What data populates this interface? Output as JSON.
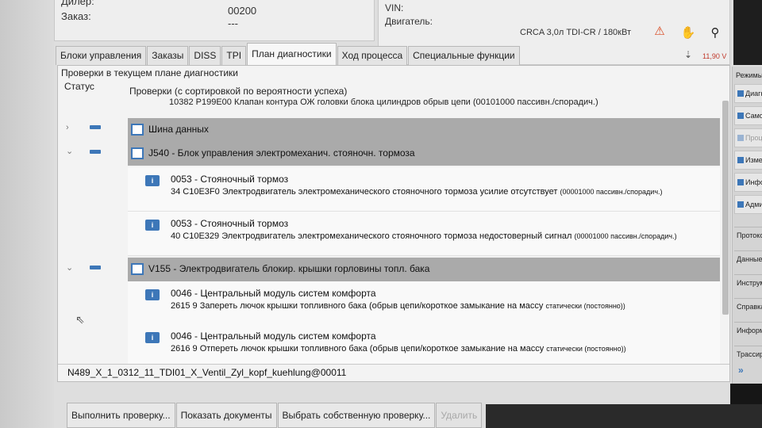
{
  "header": {
    "dealer_label": "Дилер:",
    "order_label": "Заказ:",
    "dealer_value": "00200",
    "order_value": "---",
    "vin_label": "VIN:",
    "engine_label": "Двигатель:",
    "engine_value": "CRCA 3,0л TDI-CR / 180кВт",
    "voltage": "11,90 V"
  },
  "tabs": [
    {
      "label": "Блоки управления"
    },
    {
      "label": "Заказы"
    },
    {
      "label": "DISS"
    },
    {
      "label": "TPI"
    },
    {
      "label": "План диагностики"
    },
    {
      "label": "Ход процесса"
    },
    {
      "label": "Специальные функции"
    }
  ],
  "plan": {
    "title": "Проверки в текущем плане диагностики",
    "status_header": "Статус",
    "checks_header": "Проверки (с сортировкой по вероятности успеха)",
    "main_fault": "10382   P199E00   Клапан контура ОЖ головки блока цилиндров обрыв цепи  (00101000   пассивн./спорадич.)"
  },
  "rows": {
    "data_bus": "Шина данных",
    "j540": "J540 - Блок управления электромеханич. стояночн. тормоза",
    "v155": "V155 - Электродвигатель блокир. крышки горловины топл. бака",
    "partial": "N489_X_1..."
  },
  "faults": [
    {
      "title": "0053 - Стояночный тормоз",
      "code": "34   C10E3F0   Электродвигатель электромеханического стояночного тормоза усилие отсутствует",
      "detail": "(00001000   пассивн./спорадич.)"
    },
    {
      "title": "0053 - Стояночный тормоз",
      "code": "40   C10E329   Электродвигатель электромеханического стояночного тормоза недостоверный сигнал",
      "detail": "(00001000   пассивн./спорадич.)"
    },
    {
      "title": "0046 - Центральный модуль систем комфорта",
      "code": "2615   9   Запереть лючок крышки топливного бака  (обрыв цепи/короткое замыкание на массу",
      "detail": "статически (постоянно))"
    },
    {
      "title": "0046 - Центральный модуль систем комфорта",
      "code": "2616   9   Отпереть лючок крышки топливного бака  (обрыв цепи/короткое замыкание на массу",
      "detail": "статически (постоянно))"
    }
  ],
  "file_name": "N489_X_1_0312_11_TDI01_X_Ventil_Zyl_kopf_kuehlung@00011",
  "buttons": {
    "run_check": "Выполнить проверку...",
    "show_docs": "Показать документы",
    "select_own": "Выбрать собственную проверку...",
    "delete": "Удалить"
  },
  "side": {
    "modes": "Режимы",
    "items": [
      {
        "label": "Диагн."
      },
      {
        "label": "Самод."
      },
      {
        "label": "Проц."
      },
      {
        "label": "Измер."
      },
      {
        "label": "Инфо"
      },
      {
        "label": "Админ."
      }
    ],
    "sections": [
      {
        "label": "Протокол"
      },
      {
        "label": "Данные"
      },
      {
        "label": "Инструм."
      },
      {
        "label": "Справка"
      },
      {
        "label": "Информ."
      },
      {
        "label": "Трассир."
      }
    ]
  }
}
